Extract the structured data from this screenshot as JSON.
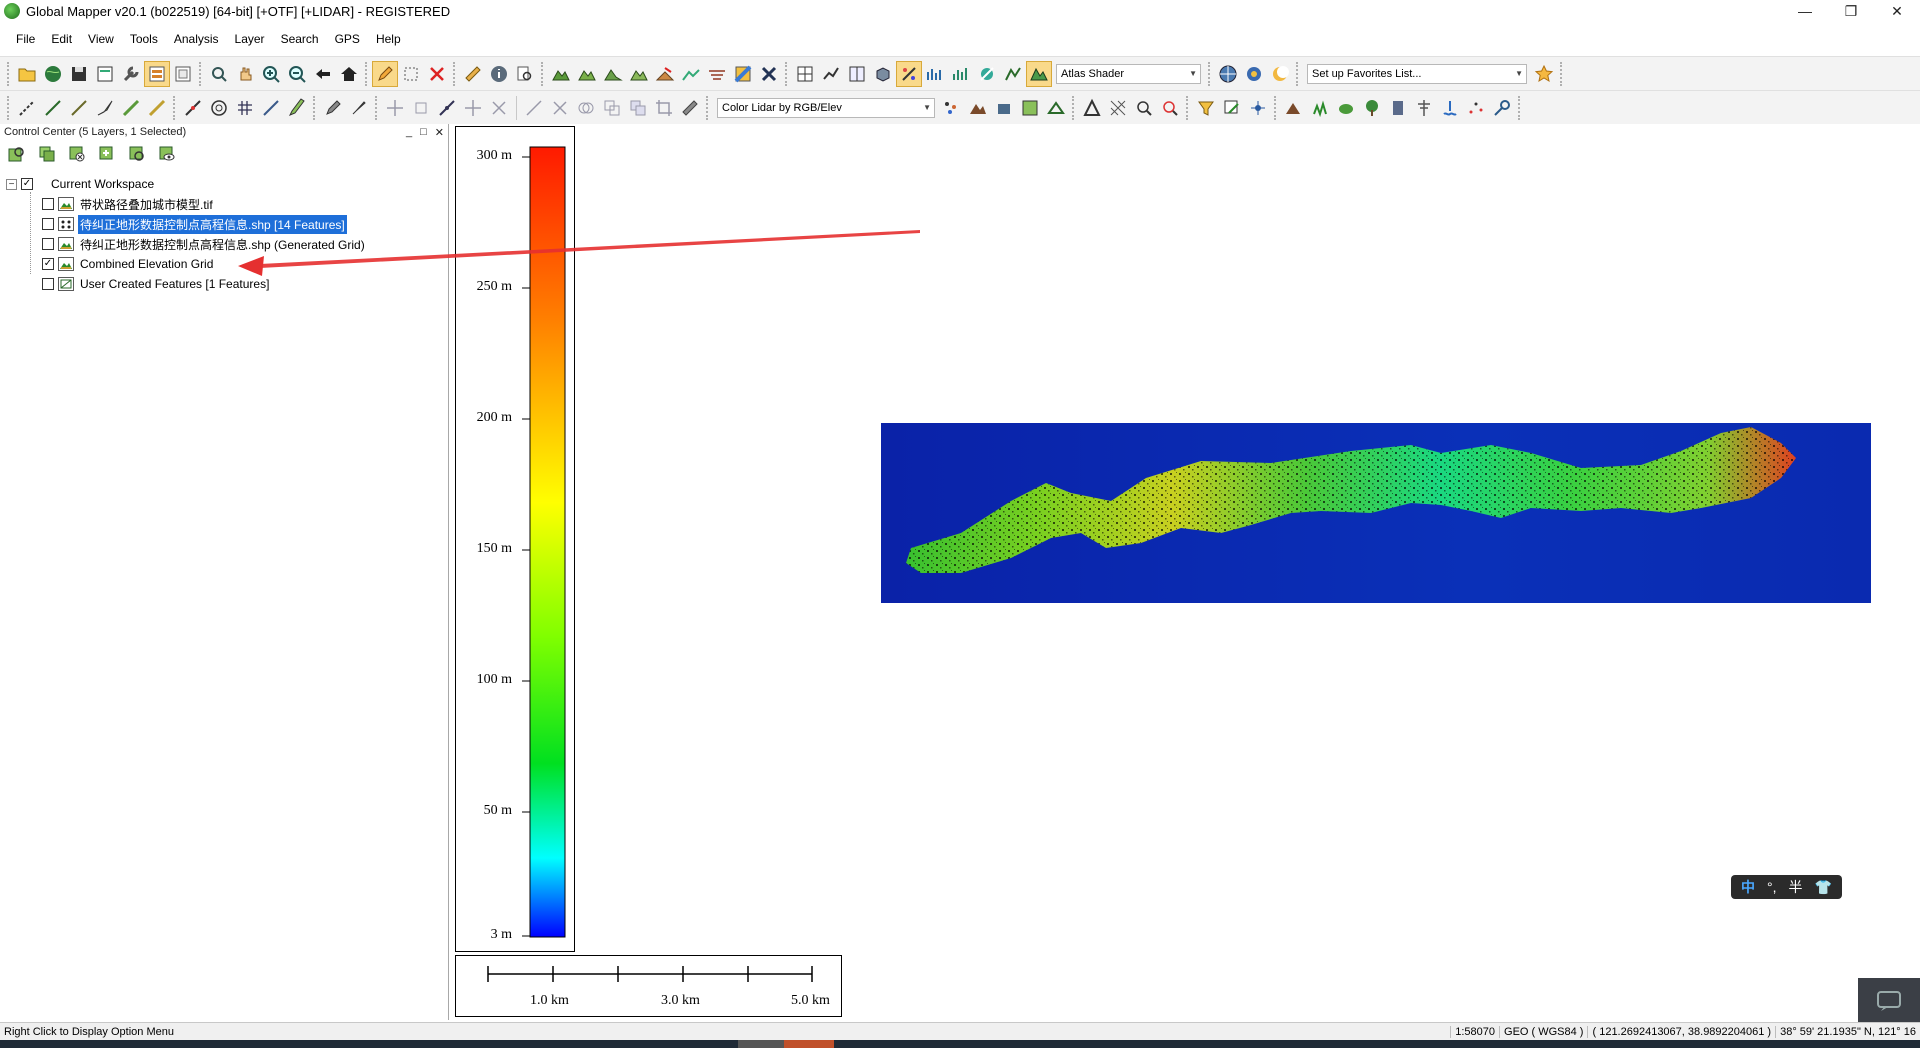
{
  "window": {
    "title": "Global Mapper v20.1 (b022519) [64-bit] [+OTF] [+LIDAR] - REGISTERED",
    "controls": [
      "—",
      "❐",
      "✕"
    ]
  },
  "menu": [
    "File",
    "Edit",
    "View",
    "Tools",
    "Analysis",
    "Layer",
    "Search",
    "GPS",
    "Help"
  ],
  "toolbar": {
    "shader_combo": "Atlas Shader",
    "favorites_combo": "Set up Favorites List...",
    "lidar_combo": "Color Lidar by RGB/Elev"
  },
  "control_center": {
    "title": "Control Center (5 Layers, 1 Selected)",
    "header_buttons": [
      "_",
      "□",
      "✕"
    ],
    "root": {
      "label": "Current Workspace",
      "expander": "⊟",
      "checked": true
    },
    "layers": [
      {
        "label": "带状路径叠加城市模型.tif",
        "checked": false,
        "selected": false,
        "icon": "raster-layer-icon"
      },
      {
        "label": "待纠正地形数据控制点高程信息.shp [14 Features]",
        "checked": false,
        "selected": true,
        "icon": "point-layer-icon"
      },
      {
        "label": "待纠正地形数据控制点高程信息.shp (Generated Grid)",
        "checked": false,
        "selected": false,
        "icon": "raster-layer-icon"
      },
      {
        "label": "Combined Elevation Grid",
        "checked": true,
        "selected": false,
        "icon": "raster-layer-icon"
      },
      {
        "label": "User Created Features [1 Features]",
        "checked": false,
        "selected": false,
        "icon": "vector-layer-icon"
      }
    ]
  },
  "elevation_legend": {
    "labels": [
      "300 m",
      "250 m",
      "200 m",
      "150 m",
      "100 m",
      "50 m",
      "3 m"
    ],
    "colors": [
      "#ff0000",
      "#ff8000",
      "#ffff00",
      "#00ff00",
      "#00ffff",
      "#0000ff"
    ]
  },
  "scale_bar": {
    "labels": [
      "1.0 km",
      "3.0 km",
      "5.0 km"
    ]
  },
  "map": {
    "background_color": "#0a2ab0",
    "annotation_color": "#e53030"
  },
  "ime": {
    "items": [
      "中",
      "°,",
      "半",
      "👕"
    ]
  },
  "status": {
    "message": "Right Click to Display Option Menu",
    "scale": "1:58070",
    "projection": "GEO ( WGS84 )",
    "coords": "( 121.2692413067, 38.9892204061 )",
    "dms": "38° 59' 21.1935\" N, 121° 16"
  }
}
